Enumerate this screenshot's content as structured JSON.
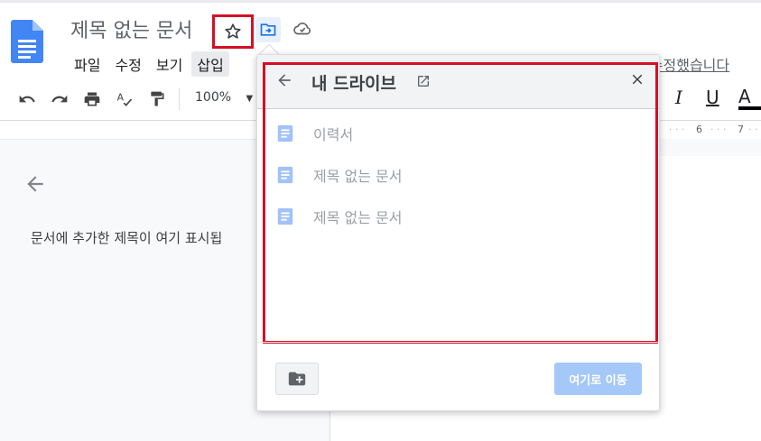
{
  "document": {
    "title": "제목 없는 문서"
  },
  "menu": [
    "파일",
    "수정",
    "보기",
    "삽입"
  ],
  "last_edit": "로 수정했습니다",
  "toolbar": {
    "zoom": "100%",
    "italic": "I",
    "underline": "U",
    "text_color": "A"
  },
  "ruler": {
    "ticks": [
      "6",
      "7"
    ]
  },
  "outline": {
    "hint": "문서에 추가한 제목이 여기 표시됩"
  },
  "move_dialog": {
    "title": "내 드라이브",
    "files": [
      {
        "name": "이력서",
        "icon": "doc-icon"
      },
      {
        "name": "제목 없는 문서",
        "icon": "doc-icon"
      },
      {
        "name": "제목 없는 문서",
        "icon": "doc-icon"
      }
    ],
    "move_here_label": "여기로 이동"
  },
  "colors": {
    "highlight": "#d50f25",
    "docs_blue": "#4285f4",
    "move_button_disabled": "#a4c8f8"
  }
}
